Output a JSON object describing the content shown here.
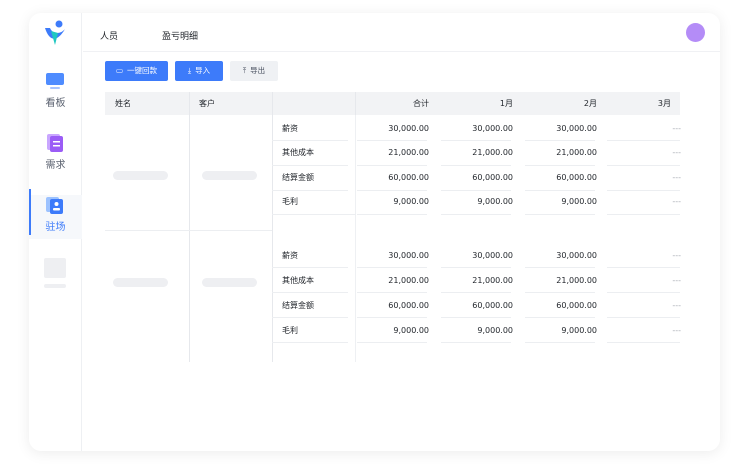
{
  "sidebar": {
    "items": [
      {
        "label": "看板"
      },
      {
        "label": "需求"
      },
      {
        "label": "驻场"
      }
    ]
  },
  "header": {
    "tabs": [
      {
        "label": "人员"
      },
      {
        "label": "盈亏明细"
      }
    ]
  },
  "toolbar": {
    "collect_label": "一键回款",
    "import_label": "导入",
    "export_label": "导出"
  },
  "table": {
    "headers": {
      "name": "姓名",
      "client": "客户",
      "total": "合计",
      "m1": "1月",
      "m2": "2月",
      "m3": "3月"
    },
    "groups": [
      {
        "rows": [
          {
            "item": "薪资",
            "total": "30,000.00",
            "m1": "30,000.00",
            "m2": "30,000.00",
            "m3": "---"
          },
          {
            "item": "其他成本",
            "total": "21,000.00",
            "m1": "21,000.00",
            "m2": "21,000.00",
            "m3": "---"
          },
          {
            "item": "结算金额",
            "total": "60,000.00",
            "m1": "60,000.00",
            "m2": "60,000.00",
            "m3": "---"
          },
          {
            "item": "毛利",
            "total": "9,000.00",
            "m1": "9,000.00",
            "m2": "9,000.00",
            "m3": "---"
          }
        ]
      },
      {
        "rows": [
          {
            "item": "薪资",
            "total": "30,000.00",
            "m1": "30,000.00",
            "m2": "30,000.00",
            "m3": "---"
          },
          {
            "item": "其他成本",
            "total": "21,000.00",
            "m1": "21,000.00",
            "m2": "21,000.00",
            "m3": "---"
          },
          {
            "item": "结算金额",
            "total": "60,000.00",
            "m1": "60,000.00",
            "m2": "60,000.00",
            "m3": "---"
          },
          {
            "item": "毛利",
            "total": "9,000.00",
            "m1": "9,000.00",
            "m2": "9,000.00",
            "m3": "---"
          }
        ]
      }
    ]
  }
}
